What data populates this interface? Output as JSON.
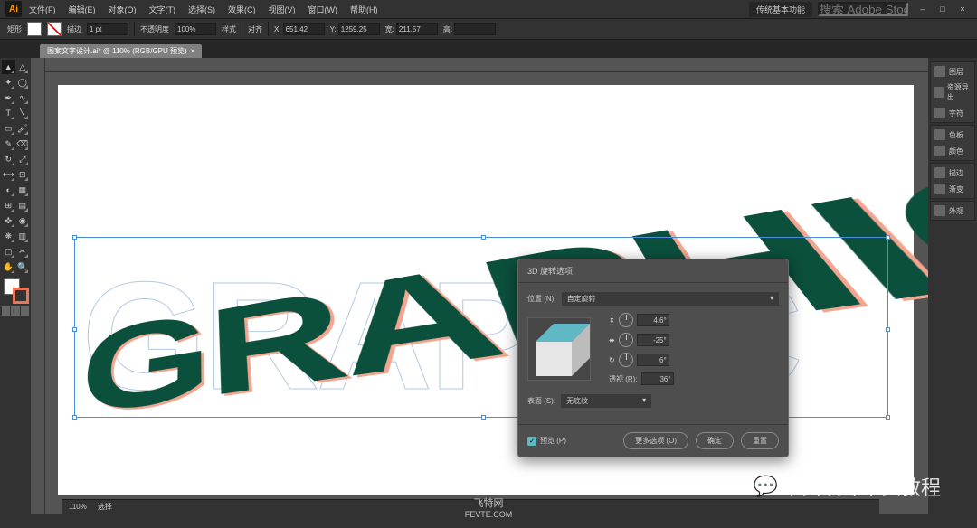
{
  "menubar": {
    "items": [
      "文件(F)",
      "编辑(E)",
      "对象(O)",
      "文字(T)",
      "选择(S)",
      "效果(C)",
      "视图(V)",
      "窗口(W)",
      "帮助(H)"
    ],
    "workspace": "传统基本功能",
    "search_placeholder": "搜索 Adobe Stock"
  },
  "options": {
    "label_type": "矩形",
    "stroke_label": "描边",
    "stroke_value": "1 pt",
    "opacity_label": "不透明度",
    "opacity_value": "100%",
    "style_label": "样式",
    "align_label": "对齐",
    "x_label": "X:",
    "x_value": "651.42",
    "y_label": "Y:",
    "y_value": "1259.25",
    "w_label": "宽:",
    "w_value": "211.57",
    "h_label": "高:"
  },
  "document": {
    "tab": "图案文字设计.ai* @ 110% (RGB/GPU 预览)",
    "close": "×"
  },
  "artwork": {
    "text": "GRAPHIC"
  },
  "dialog": {
    "title": "3D 旋转选项",
    "position_label": "位置 (N):",
    "position_value": "自定旋转",
    "axis_x": "4.6°",
    "axis_y": "-25°",
    "axis_z": "6°",
    "perspective_label": "透视 (R):",
    "perspective_value": "36°",
    "surface_label": "表面 (S):",
    "surface_value": "无底纹",
    "preview_label": "预览 (P)",
    "more_options": "更多选项 (O)",
    "ok": "确定",
    "reset": "重置"
  },
  "panels": {
    "g1": [
      "图层",
      "资源导出",
      "字符"
    ],
    "g2": [
      "色板",
      "颜色"
    ],
    "g3": [
      "描边",
      "渐变"
    ],
    "g4": [
      "外观"
    ]
  },
  "status": {
    "zoom": "110%",
    "tool": "选择"
  },
  "watermark": {
    "right": "平面设计干货教程",
    "center1": "飞特网",
    "center2": "FEVTE.COM"
  }
}
